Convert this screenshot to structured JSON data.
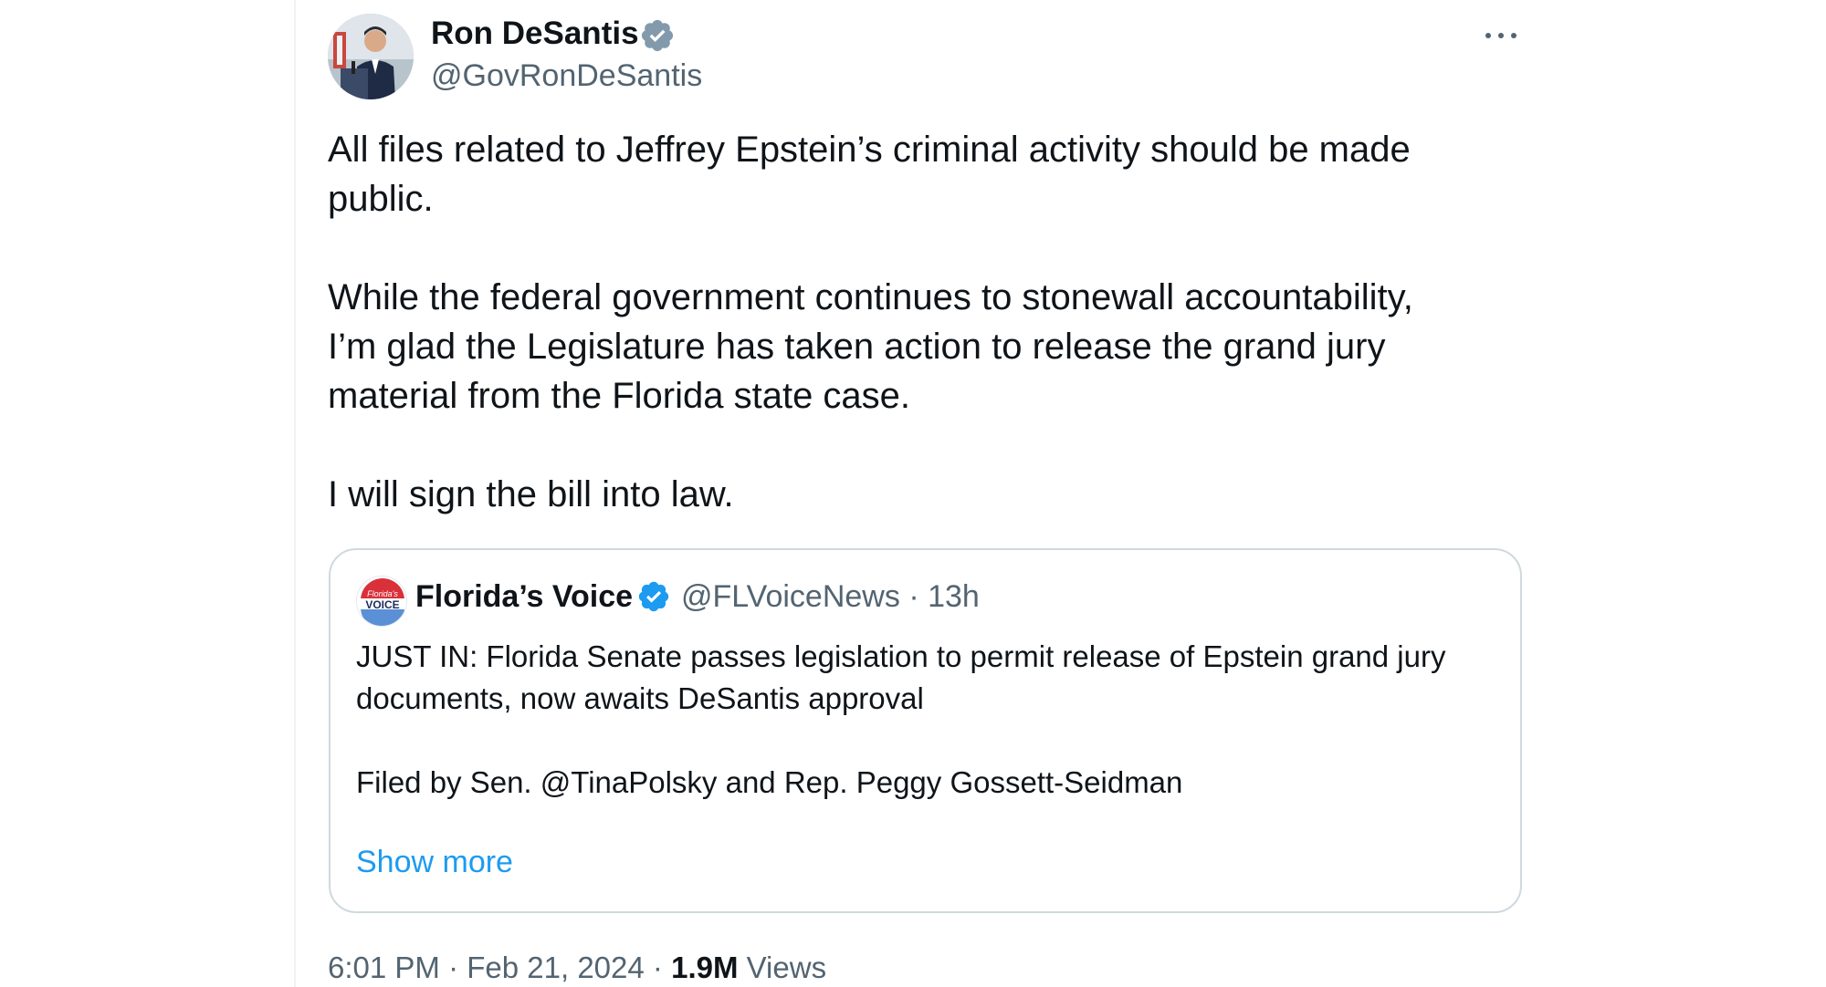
{
  "author": {
    "name": "Ron DeSantis",
    "handle": "@GovRonDeSantis",
    "verified_badge_color": "#829aab"
  },
  "tweet": {
    "paragraphs": [
      [
        "All files related to Jeffrey Epstein’s criminal activity should be made",
        "public."
      ],
      [
        "While the federal government continues to stonewall accountability,",
        "I’m glad the Legislature has taken action to release the grand jury",
        "material from the Florida state case."
      ],
      [
        "I will sign the bill into law."
      ]
    ]
  },
  "quote": {
    "name": "Florida’s Voice",
    "handle": "@FLVoiceNews",
    "separator": "·",
    "time": "13h",
    "verified_badge_color": "#1d9bf0",
    "avatar_text": {
      "top": "Florida's",
      "bottom": "VOICE"
    },
    "lines": [
      "JUST IN: Florida Senate passes legislation to permit release of Epstein grand jury",
      "documents, now awaits DeSantis approval"
    ],
    "line2": "Filed by Sen. @TinaPolsky and Rep. Peggy Gossett-Seidman",
    "show_more": "Show more"
  },
  "meta": {
    "time": "6:01 PM",
    "sep1": "·",
    "date": "Feb 21, 2024",
    "sep2": "·",
    "views_count": "1.9M",
    "views_label": "Views"
  },
  "colors": {
    "text_primary": "#0f1419",
    "text_secondary": "#536471",
    "link": "#1d9bf0",
    "border": "#cfd9de"
  },
  "icons": {
    "more": "more-horizontal-icon",
    "verified": "verified-badge-icon"
  }
}
